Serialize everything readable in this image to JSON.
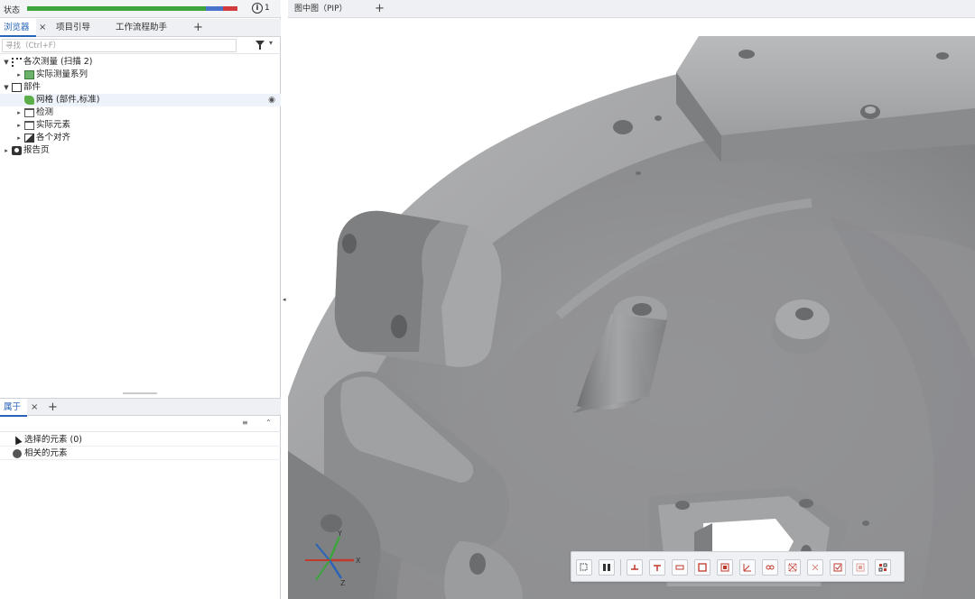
{
  "status": {
    "label": "状态",
    "progress_fraction": 1.0,
    "info_count": "1"
  },
  "browser_tabs": [
    {
      "label": "浏览器",
      "active": true
    },
    {
      "label": "项目引导",
      "active": false
    },
    {
      "label": "工作流程助手",
      "active": false
    }
  ],
  "browser_tab_add": "+",
  "tab_close": "×",
  "search": {
    "placeholder": "寻找（Ctrl+F）",
    "value": ""
  },
  "filter_dropdown": "▾",
  "tree": [
    {
      "label": "各次测量 (扫描 2)",
      "icon": "scan-icon",
      "level": 0,
      "expanded": true
    },
    {
      "label": "实际测量系列",
      "icon": "measurement-series-icon",
      "level": 1,
      "expanded": false
    },
    {
      "label": "部件",
      "icon": "part-icon",
      "level": 0,
      "expanded": true
    },
    {
      "label": "网格 (部件,标准)",
      "icon": "mesh-icon",
      "level": 1,
      "expanded": null
    },
    {
      "label": "检测",
      "icon": "folder-icon",
      "level": 1,
      "expanded": false
    },
    {
      "label": "实际元素",
      "icon": "folder-icon",
      "level": 1,
      "expanded": false
    },
    {
      "label": "各个对齐",
      "icon": "alignment-icon",
      "level": 1,
      "expanded": false
    },
    {
      "label": "报告页",
      "icon": "camera-icon",
      "level": 0,
      "expanded": false
    }
  ],
  "properties_tab": {
    "label": "属于"
  },
  "properties_tab_add": "+",
  "properties_rows": [
    {
      "label": "选择的元素 (0)",
      "icon": "cursor-icon"
    },
    {
      "label": "相关的元素",
      "icon": "related-elements-icon"
    }
  ],
  "viewport": {
    "tab_label": "图中图（PIP）",
    "tab_add": "+"
  },
  "axis": {
    "x": "X",
    "y": "Y",
    "z": "Z"
  },
  "toolbar_icons": [
    "select-region-icon",
    "split-view-icon",
    "flush-icon",
    "gap-icon",
    "section-icon",
    "boundary-icon",
    "planarity-icon",
    "angle-icon",
    "link-icon",
    "grid-check-icon",
    "fixture-icon",
    "check-icon",
    "report-icon",
    "layout-icon"
  ],
  "colors": {
    "accent": "#2a64b8",
    "progress_green": "#3da33d",
    "progress_blue": "#4a74c9",
    "progress_red": "#d23b3b",
    "mesh_gray": "#8f9092",
    "toolbar_icon_red": "#c0392b"
  }
}
